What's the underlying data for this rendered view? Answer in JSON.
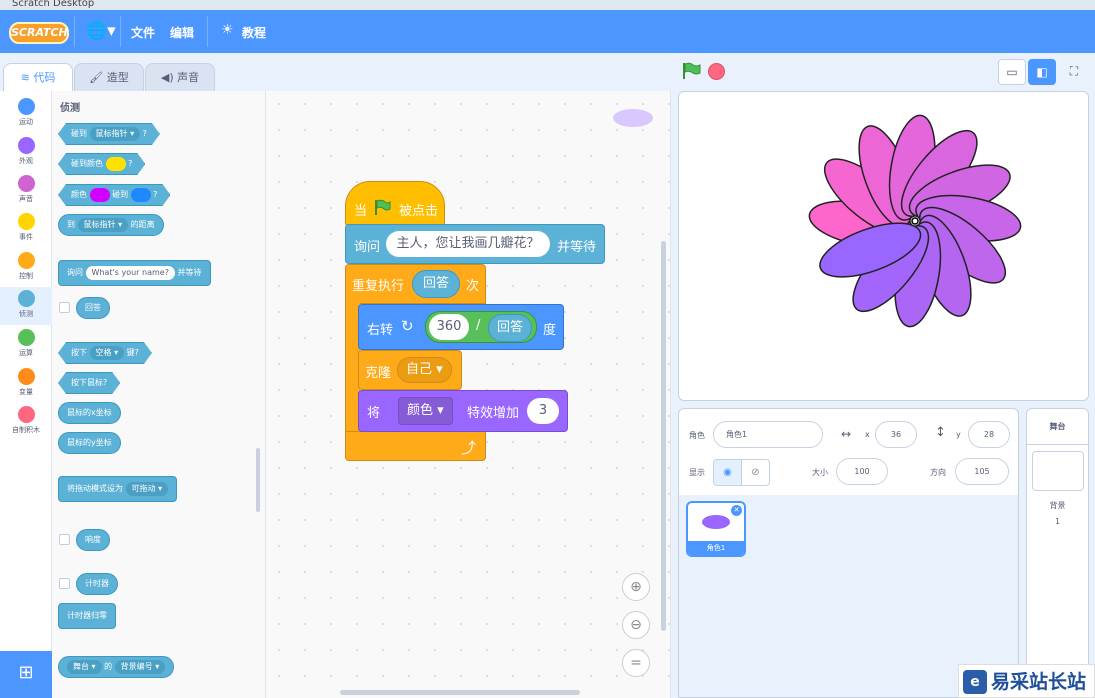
{
  "window": {
    "title": "Scratch Desktop"
  },
  "menubar": {
    "logo": "SCRATCH",
    "file": "文件",
    "edit": "编辑",
    "tutorials": "教程"
  },
  "tabs": [
    {
      "label": "代码"
    },
    {
      "label": "造型"
    },
    {
      "label": "声音"
    }
  ],
  "categories": [
    {
      "label": "运动",
      "color": "#4c97ff"
    },
    {
      "label": "外观",
      "color": "#9966ff"
    },
    {
      "label": "声音",
      "color": "#cf63cf"
    },
    {
      "label": "事件",
      "color": "#ffd500"
    },
    {
      "label": "控制",
      "color": "#ffab19"
    },
    {
      "label": "侦测",
      "color": "#5cb1d6"
    },
    {
      "label": "运算",
      "color": "#59c059"
    },
    {
      "label": "变量",
      "color": "#ff8c1a"
    },
    {
      "label": "自制积木",
      "color": "#ff6680"
    }
  ],
  "palette": {
    "title": "侦测",
    "touching": "碰到",
    "mouse_pointer": "鼠标指针",
    "touching_color": "碰到颜色",
    "color": "颜色",
    "touches": "碰到",
    "to": "到",
    "distance_of": "的距离",
    "ask": "询问",
    "ask_default": "What's your name?",
    "and_wait": "并等待",
    "answer": "回答",
    "key_pressed_prefix": "按下",
    "space": "空格",
    "key_pressed_suffix": "键?",
    "mouse_down": "按下鼠标?",
    "mouse_x": "鼠标的x坐标",
    "mouse_y": "鼠标的y坐标",
    "drag_mode": "将拖动模式设为",
    "draggable": "可拖动",
    "loudness": "响度",
    "timer": "计时器",
    "reset_timer": "计时器归零",
    "stage": "舞台",
    "of": "的",
    "backdrop_number": "背景编号"
  },
  "script": {
    "when": "当",
    "clicked": "被点击",
    "ask": "询问",
    "ask_text": "主人，您让我画几瓣花？",
    "and_wait": "并等待",
    "repeat": "重复执行",
    "times": "次",
    "answer": "回答",
    "turn_right": "右转",
    "turn_value": "360",
    "divide": "/",
    "degrees": "度",
    "clone": "克隆",
    "myself": "自己",
    "set": "将",
    "effect": "颜色",
    "change_by": "特效增加",
    "change_value": "3"
  },
  "sprite_info": {
    "sprite_label": "角色",
    "sprite_name": "角色1",
    "x_label": "x",
    "x_value": "36",
    "y_label": "y",
    "y_value": "28",
    "show_label": "显示",
    "size_label": "大小",
    "size_value": "100",
    "direction_label": "方向",
    "direction_value": "105"
  },
  "sprites": [
    {
      "name": "角色1"
    }
  ],
  "stage_pane": {
    "title": "舞台",
    "backdrops_label": "背景",
    "backdrops_count": "1"
  },
  "watermark": {
    "text": "易采站长站"
  },
  "colors": {
    "blue": "#4c97ff",
    "sensing": "#5cb1d6",
    "control": "#ffab19",
    "events": "#ffbf00",
    "looks": "#9966ff",
    "operators": "#59c059"
  },
  "petals": {
    "count": 12,
    "color_start": "#ff66cc",
    "color_end": "#9966ff"
  }
}
